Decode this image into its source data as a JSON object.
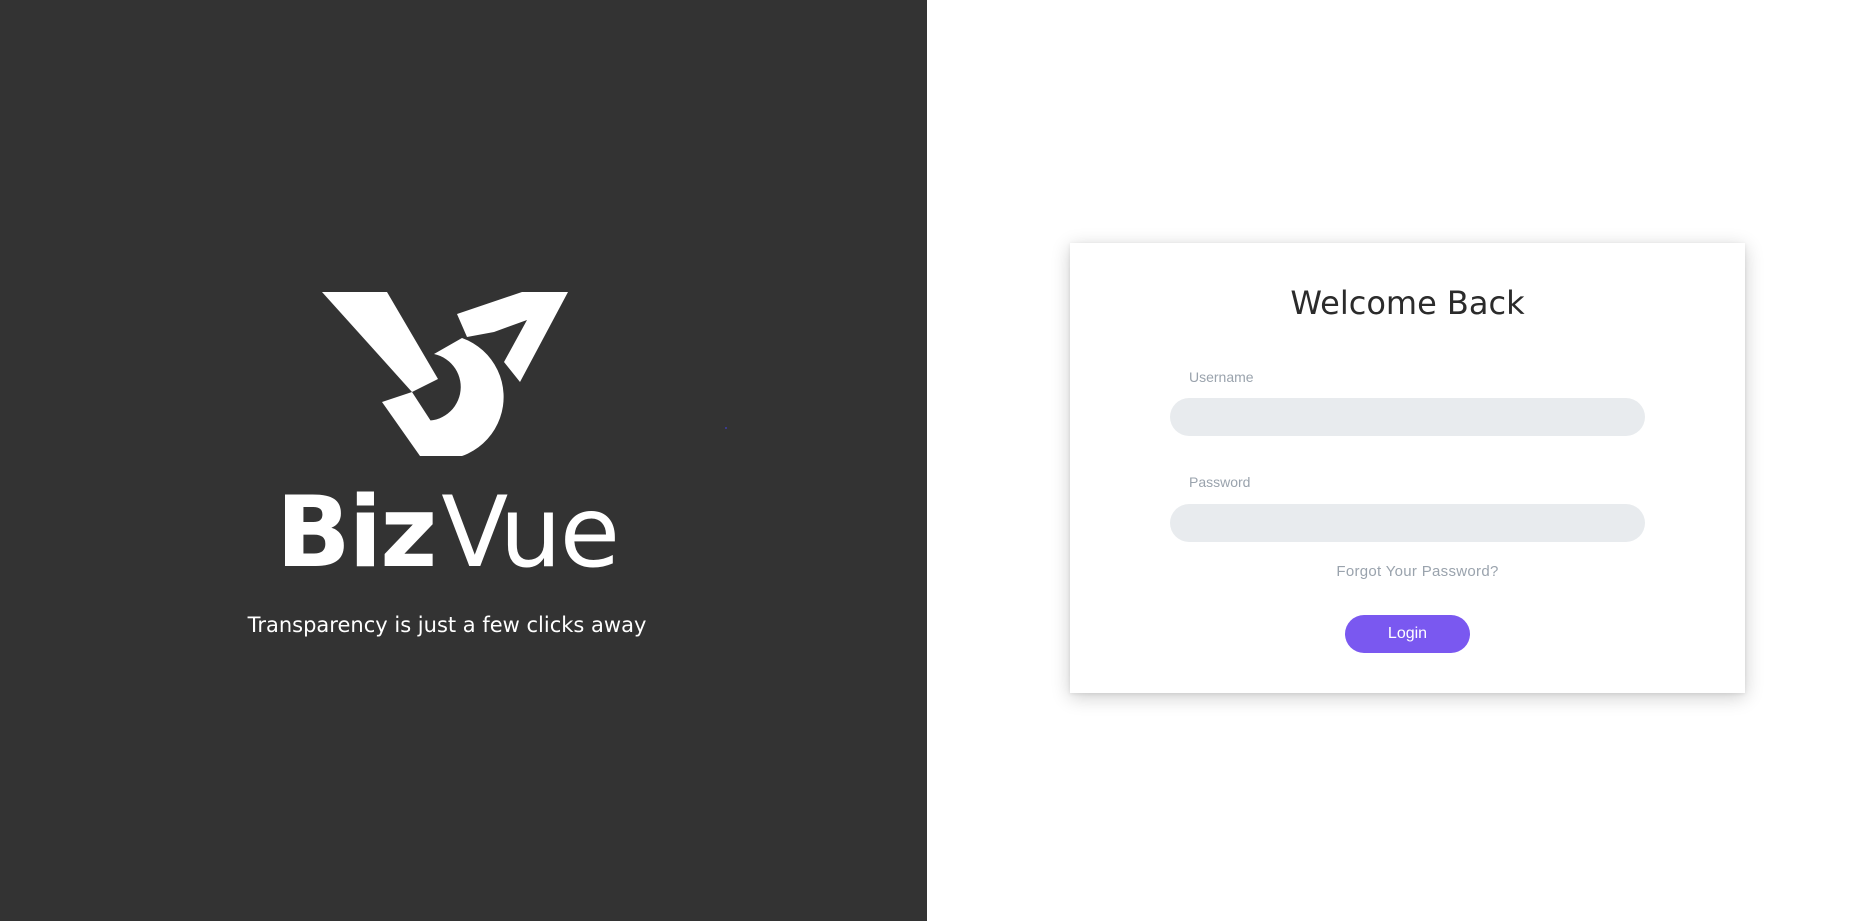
{
  "brand": {
    "logo_mark_icon": "bizvue-logo-mark",
    "name_part1": "Biz",
    "name_part2": "Vue",
    "tagline": "Transparency is just a few clicks away",
    "panel_color": "#333333"
  },
  "login": {
    "title": "Welcome Back",
    "username_label": "Username",
    "username_value": "",
    "password_label": "Password",
    "password_value": "",
    "forgot_password": "Forgot Your Password?",
    "login_button": "Login",
    "accent_color": "#7a58f0"
  }
}
